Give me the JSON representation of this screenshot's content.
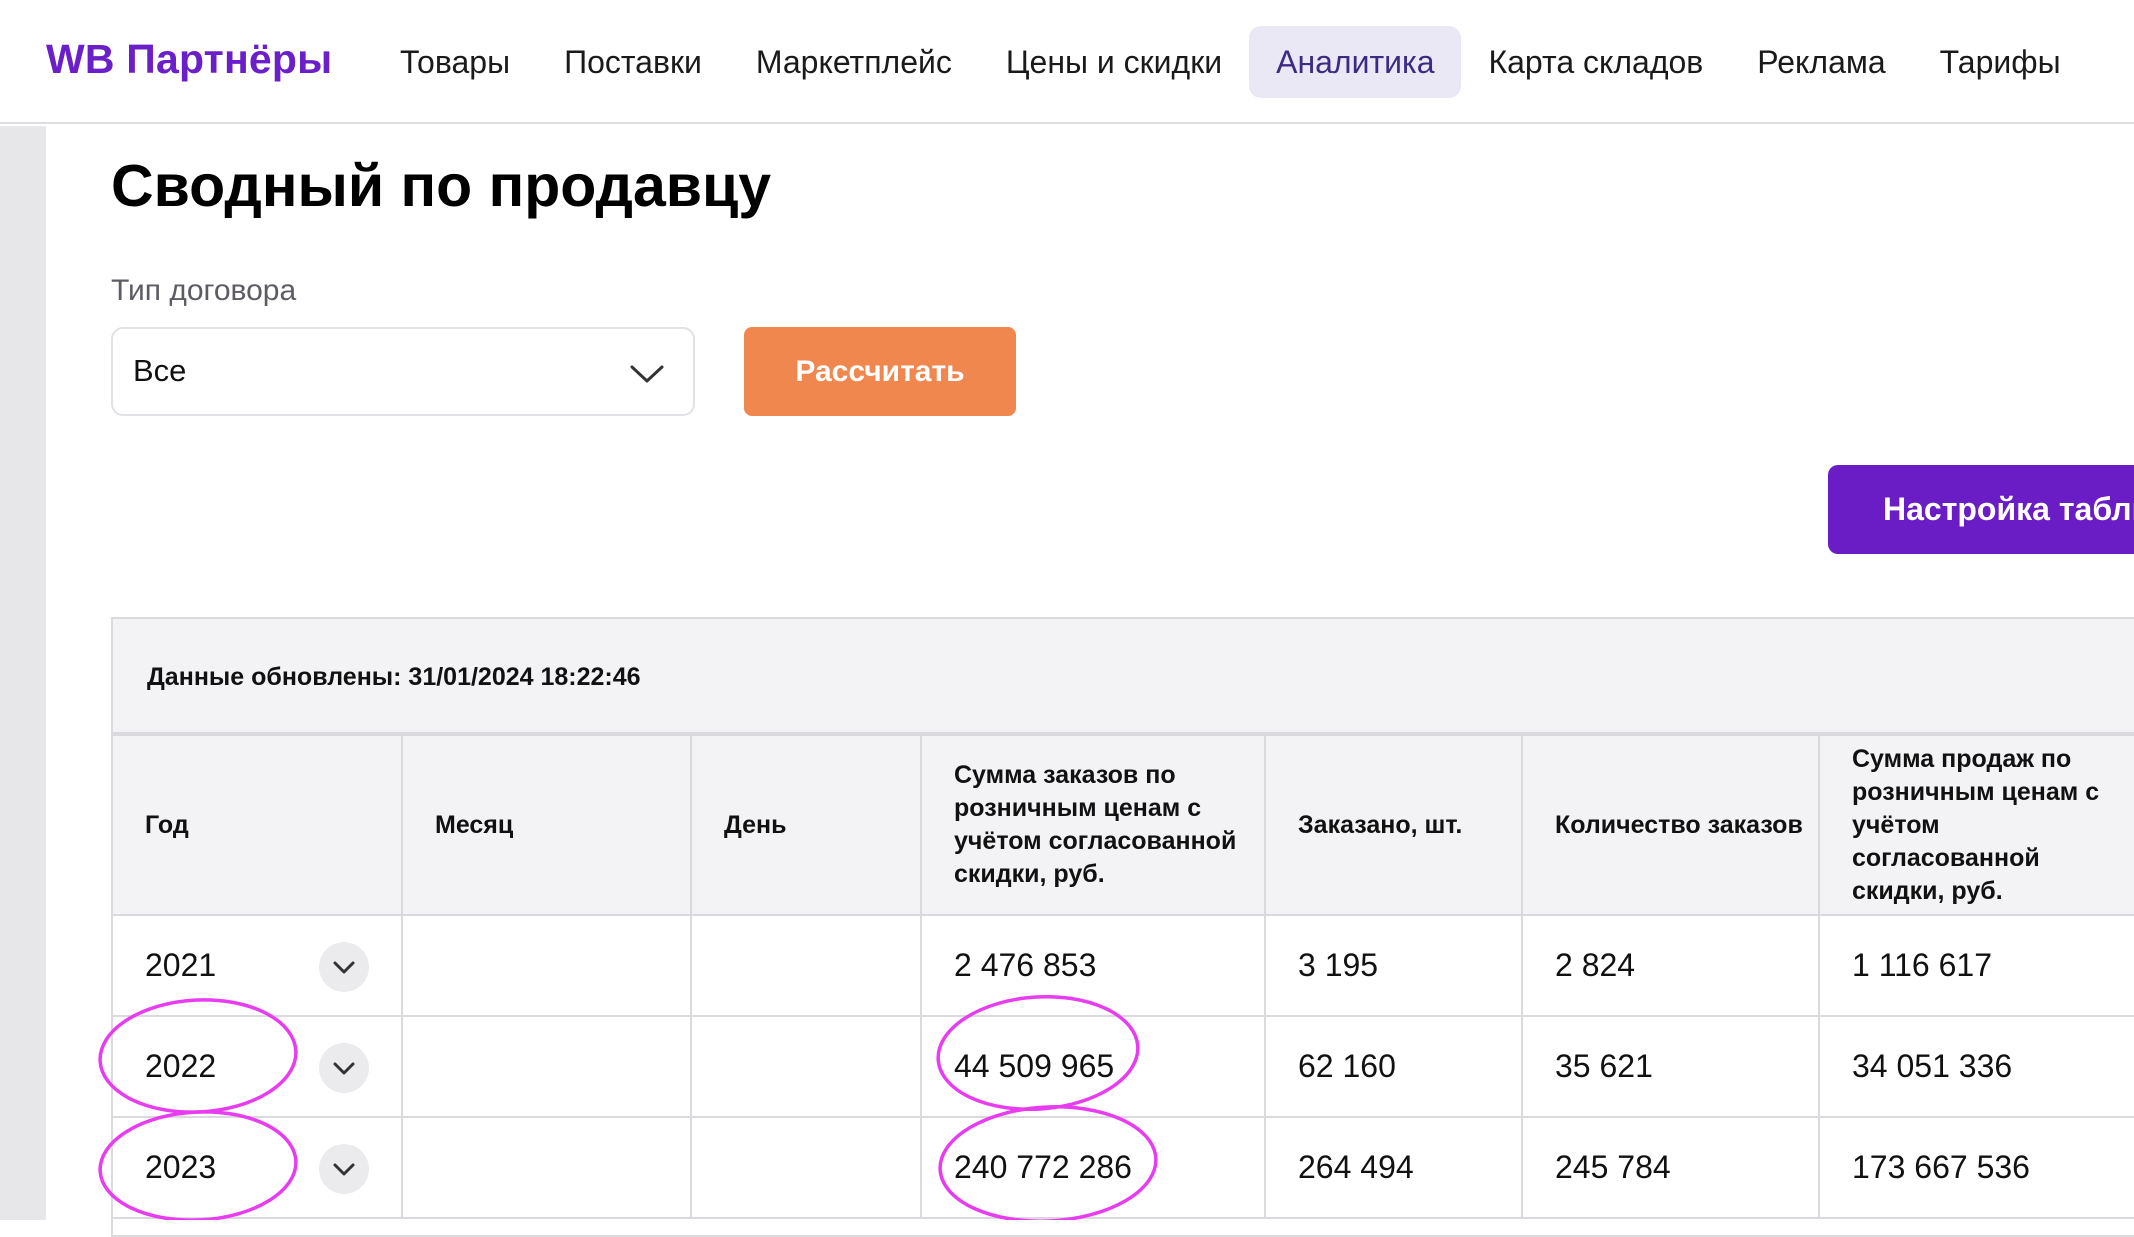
{
  "header": {
    "logo": "WB Партнёры",
    "nav": [
      "Товары",
      "Поставки",
      "Маркетплейс",
      "Цены и скидки",
      "Аналитика",
      "Карта складов",
      "Реклама",
      "Тарифы"
    ]
  },
  "page": {
    "title": "Сводный по продавцу",
    "contract_label": "Тип договора",
    "contract_value": "Все",
    "calc_button": "Рассчитать",
    "settings_button": "Настройка табли"
  },
  "table": {
    "updated": "Данные обновлены: 31/01/2024 18:22:46",
    "columns": [
      "Год",
      "Месяц",
      "День",
      "Сумма заказов по розничным ценам с учётом согласованной скидки, руб.",
      "Заказано, шт.",
      "Количество заказов",
      "Сумма продаж по розничным ценам с учётом согласованной скидки, руб."
    ],
    "rows": [
      [
        "2021",
        "",
        "",
        "2 476 853",
        "3 195",
        "2 824",
        "1 116 617"
      ],
      [
        "2022",
        "",
        "",
        "44 509 965",
        "62 160",
        "35 621",
        "34 051 336"
      ],
      [
        "2023",
        "",
        "",
        "240 772 286",
        "264 494",
        "245 784",
        "173 667 536"
      ]
    ]
  },
  "colors": {
    "brand": "#6b1fc9",
    "calc_button": "#f0874f",
    "settings_button": "#6a1cc5",
    "annotation": "#e83cf0"
  }
}
